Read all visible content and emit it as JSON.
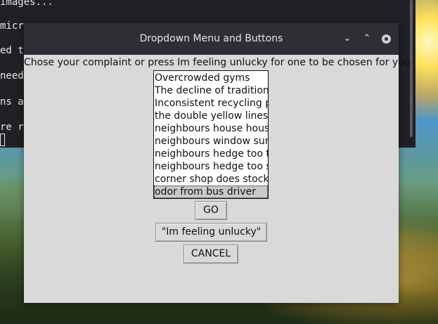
{
  "terminal": {
    "lines": [
      "images...",
      "micro",
      "ed to",
      "need",
      "ns a",
      "re r"
    ]
  },
  "window": {
    "title": "Dropdown Menu and Buttons",
    "controls": {
      "minimize": "⌄",
      "maximize": "⌃"
    },
    "prompt": "Chose your complaint or press Im feeling unlucky for one to be chosen for you",
    "complaints": [
      "Overcrowded gyms",
      "The decline of traditiona",
      "Inconsistent recycling pr",
      "the double yellow lines a",
      "neighbours house house",
      "neighbours window sunli",
      "neighbours hedge too tal",
      "neighbours hedge too sh",
      "corner shop does stock r",
      "odor from bus driver"
    ],
    "selected_index": 9,
    "buttons": {
      "go": "GO",
      "unlucky": "\"Im feeling unlucky\"",
      "cancel": "CANCEL"
    }
  },
  "colors": {
    "window_bg": "#d9d9d9",
    "titlebar_bg": "#2d2f34",
    "terminal_bg": "#1f2125"
  }
}
